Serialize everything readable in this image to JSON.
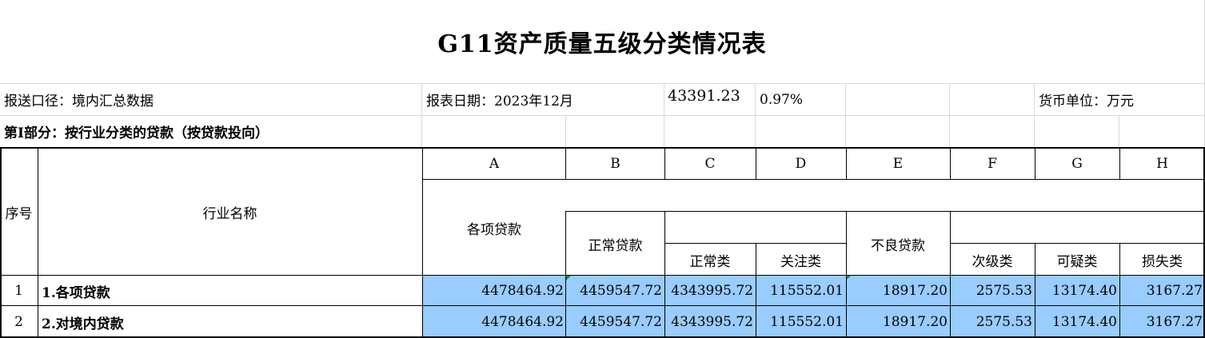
{
  "title": "G11资产质量五级分类情况表",
  "info": {
    "scope": "报送口径：境内汇总数据",
    "report_date": "报表日期：2023年12月",
    "value": "43391.23",
    "ratio": "0.97%",
    "currency": "货币单位：万元"
  },
  "section_title": "第Ⅰ部分：按行业分类的贷款（按贷款投向）",
  "columns": {
    "letters": [
      "A",
      "B",
      "C",
      "D",
      "E",
      "F",
      "G",
      "H"
    ],
    "seq": "序号",
    "industry": "行业名称",
    "total_loans": "各项贷款",
    "normal_loans": "正常贷款",
    "normal_class": "正常类",
    "special_mention": "关注类",
    "npl": "不良贷款",
    "substandard": "次级类",
    "doubtful": "可疑类",
    "loss": "损失类"
  },
  "rows": [
    {
      "seq": "1",
      "name": "1.各项贷款",
      "values": [
        "4478464.92",
        "4459547.72",
        "4343995.72",
        "115552.01",
        "18917.20",
        "2575.53",
        "13174.40",
        "3167.27"
      ]
    },
    {
      "seq": "2",
      "name": "2.对境内贷款",
      "values": [
        "4478464.92",
        "4459547.72",
        "4343995.72",
        "115552.01",
        "18917.20",
        "2575.53",
        "13174.40",
        "3167.27"
      ]
    }
  ]
}
